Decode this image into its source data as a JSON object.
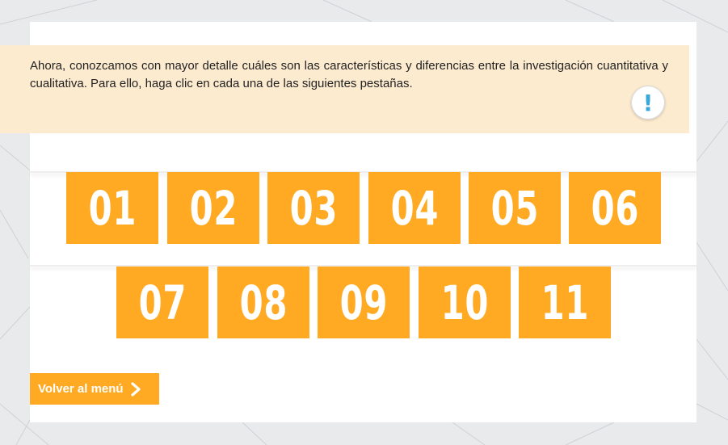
{
  "intro": {
    "text": "Ahora, conozcamos con mayor detalle cuáles son las características y diferencias entre la investigación cuantitativa y cualitativa. Para ello, haga clic en cada una de las siguientes pestañas."
  },
  "alert_icon": {
    "glyph": "!",
    "icon": "exclamation-icon"
  },
  "tabs_row1": [
    {
      "label": "01"
    },
    {
      "label": "02"
    },
    {
      "label": "03"
    },
    {
      "label": "04"
    },
    {
      "label": "05"
    },
    {
      "label": "06"
    }
  ],
  "tabs_row2": [
    {
      "label": "07"
    },
    {
      "label": "08"
    },
    {
      "label": "09"
    },
    {
      "label": "10"
    },
    {
      "label": "11"
    }
  ],
  "back_button": {
    "label": "Volver al menú",
    "icon": "chevron-right-icon"
  },
  "colors": {
    "accent": "#ffaa22",
    "note_bg": "#fdebcf",
    "icon": "#3aa7d9"
  }
}
